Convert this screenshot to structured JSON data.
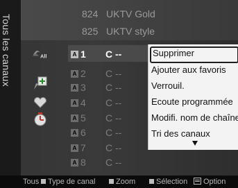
{
  "sidebar": {
    "tab_label": "Tous les canaux"
  },
  "top_channels": [
    {
      "number": "824",
      "name": "UKTV Gold"
    },
    {
      "number": "825",
      "name": "UKTV style"
    }
  ],
  "filter_icons": [
    {
      "name": "all-channels-icon",
      "label": "All"
    },
    {
      "name": "added-channels-icon"
    },
    {
      "name": "favorites-icon"
    },
    {
      "name": "programmed-icon"
    }
  ],
  "channel_list": [
    {
      "badge": "A",
      "number": "1",
      "name": "C --",
      "active": true
    },
    {
      "badge": "A",
      "number": "2",
      "name": "C --"
    },
    {
      "badge": "A",
      "number": "3",
      "name": "C --"
    },
    {
      "badge": "A",
      "number": "4",
      "name": "C --"
    },
    {
      "badge": "A",
      "number": "5",
      "name": "C --"
    },
    {
      "badge": "A",
      "number": "6",
      "name": "C --"
    },
    {
      "badge": "A",
      "number": "7",
      "name": "C --"
    },
    {
      "badge": "A",
      "number": "8",
      "name": "C --"
    }
  ],
  "options_menu": {
    "items": [
      "Supprimer",
      "Ajouter aux favoris",
      "Verrouil.",
      "Ecoute programmée",
      "Modifi. nom de chaîne",
      "Tri des canaux"
    ],
    "selected_index": 0
  },
  "footer": {
    "all": "Tous",
    "channel_type": "Type de canal",
    "zoom": "Zoom",
    "selection": "Sélection",
    "option": "Option"
  }
}
